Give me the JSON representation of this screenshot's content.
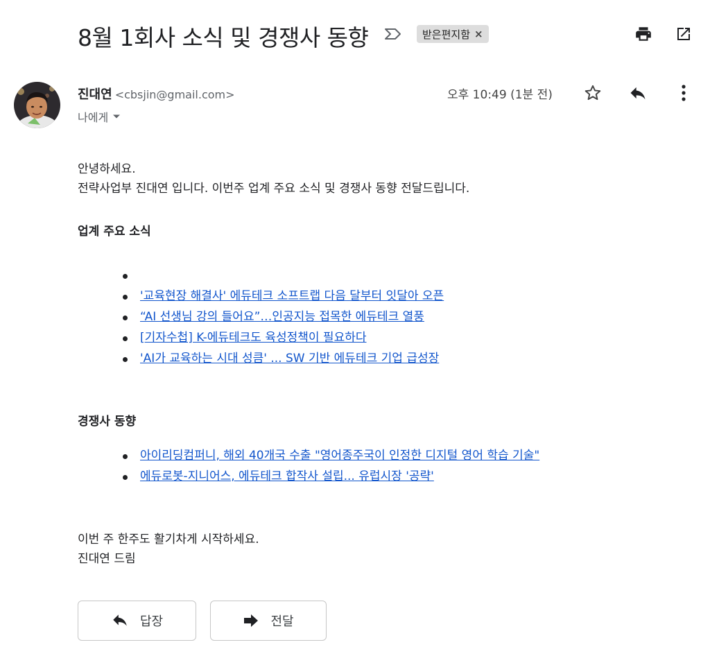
{
  "subject": "8월 1회사 소식 및 경쟁사 동향",
  "label_chip": {
    "label": "받은편지함",
    "remove": "×"
  },
  "toolbar_icons": [
    "print-icon",
    "open-in-new-window-icon"
  ],
  "sender": {
    "name": "진대연",
    "email": "<cbsjin@gmail.com>",
    "to": "나에게",
    "time": "오후 10:49 (1분 전)"
  },
  "actions_icons": [
    "star-icon",
    "reply-icon",
    "more-vert-icon"
  ],
  "body": {
    "greeting": "안녕하세요.",
    "intro": "전략사업부 진대연 입니다. 이번주 업계 주요 소식 및 경쟁사 동향 전달드립니다.",
    "section1": {
      "title": "업계 주요 소식",
      "items": [
        "",
        "'교육현장 해결사' 에듀테크 소프트랩 다음 달부터 잇달아 오픈",
        "“AI 선생님 강의 들어요”…인공지능 접목한 에듀테크 열풍",
        "[기자수첩] K-에듀테크도 육성정책이 필요하다",
        "'AI가 교육하는 시대 성큼' ... SW 기반 에듀테크 기업 급성장"
      ]
    },
    "section2": {
      "title": "경쟁사 동향",
      "items": [
        "아이리딩컴퍼니, 해외 40개국 수출 \"영어종주국이 인정한 디지털 영어 학습 기술\"",
        "에듀로봇-지니어스, 에듀테크 합작사 설립... 유럽시장 '공략'"
      ]
    },
    "closing": "이번 주 한주도 활기차게 시작하세요.",
    "signature": "진대연 드림"
  },
  "buttons": {
    "reply": "답장",
    "forward": "전달"
  },
  "colors": {
    "link": "#1155cc",
    "chip_bg": "#dddddd",
    "text": "#202124",
    "meta": "#5f6368"
  }
}
